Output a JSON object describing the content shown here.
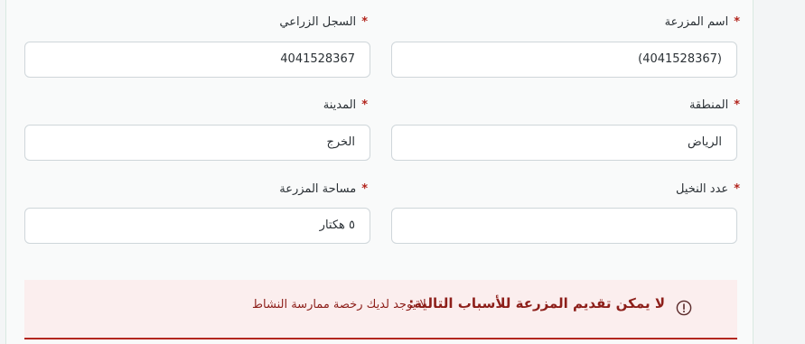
{
  "form": {
    "farm_name": {
      "label": "اسم المزرعة",
      "value": "(4041528367)"
    },
    "agri_record": {
      "label": "السجل الزراعي",
      "value": "4041528367"
    },
    "region": {
      "label": "المنطقة",
      "value": "الرياض"
    },
    "city": {
      "label": "المدينة",
      "value": "الخرج"
    },
    "palm_count": {
      "label": "عدد النخيل",
      "value": ""
    },
    "farm_area": {
      "label": "مساحة المزرعة",
      "value": "٥ هكتار"
    },
    "required_mark": "*"
  },
  "alert": {
    "title": "لا يمكن تقديم المزرعة للأسباب التالية:",
    "reason": "لا يوجد لديك رخصة ممارسة النشاط",
    "icon": "exclamation-circle-icon",
    "color": "#b3261e"
  }
}
